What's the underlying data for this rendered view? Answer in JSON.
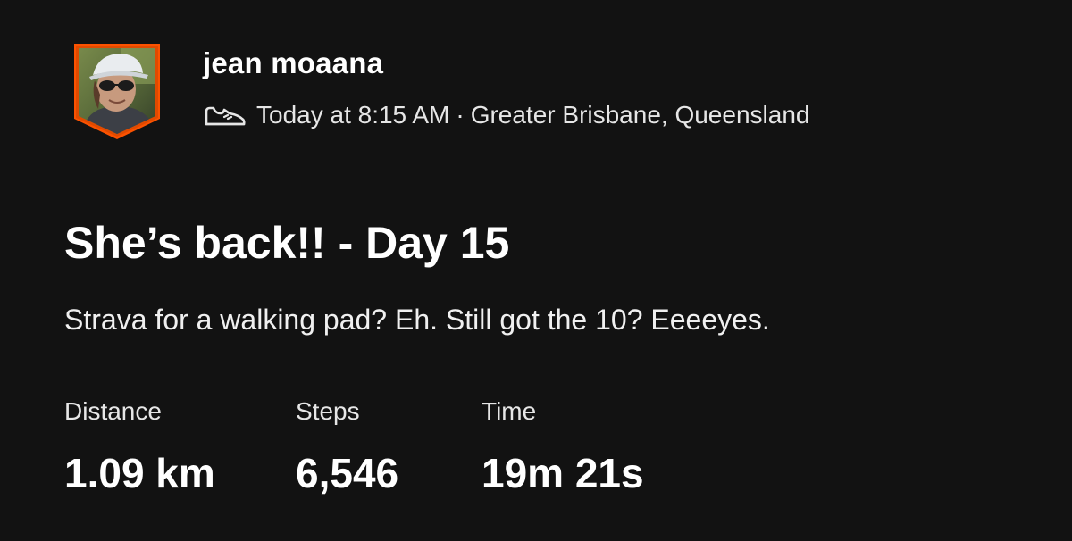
{
  "athlete": {
    "name": "jean moaana"
  },
  "activity": {
    "sport_icon": "walking-shoe-icon",
    "time": "Today at 8:15 AM",
    "separator": "·",
    "location": "Greater Brisbane, Queensland",
    "title": "She’s back!! - Day 15",
    "description": "Strava for a walking pad? Eh. Still got the 10? Eeeeyes."
  },
  "stats": [
    {
      "label": "Distance",
      "value": "1.09 km"
    },
    {
      "label": "Steps",
      "value": "6,546"
    },
    {
      "label": "Time",
      "value": "19m 21s"
    }
  ],
  "colors": {
    "background": "#121212",
    "avatar_border": "#fc5200",
    "text": "#ffffff"
  }
}
